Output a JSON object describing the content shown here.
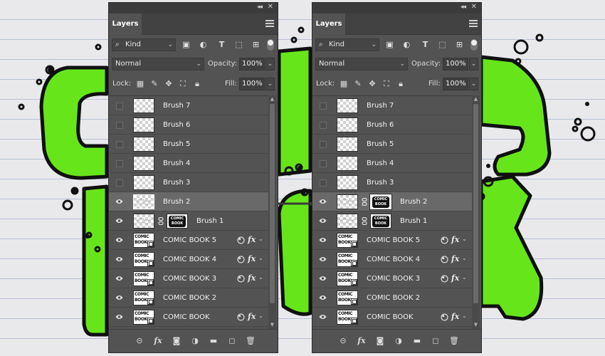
{
  "panel_left": {
    "tab_label": "Layers",
    "kind_label": "Kind",
    "blend_mode": "Normal",
    "opacity_label": "Opacity:",
    "opacity_value": "100%",
    "lock_label": "Lock:",
    "fill_label": "Fill:",
    "fill_value": "100%",
    "layers": [
      {
        "name": "Brush 7",
        "visible": false,
        "type": "pixel"
      },
      {
        "name": "Brush 6",
        "visible": false,
        "type": "pixel"
      },
      {
        "name": "Brush 5",
        "visible": false,
        "type": "pixel"
      },
      {
        "name": "Brush 4",
        "visible": false,
        "type": "pixel"
      },
      {
        "name": "Brush 3",
        "visible": false,
        "type": "pixel"
      },
      {
        "name": "Brush 2",
        "visible": true,
        "type": "pixel",
        "selected": true
      },
      {
        "name": "Brush 1",
        "visible": true,
        "type": "masked",
        "mask_text": "COMIC BOOK"
      },
      {
        "name": "COMIC BOOK 5",
        "visible": true,
        "type": "smart",
        "fx": true
      },
      {
        "name": "COMIC BOOK 4",
        "visible": true,
        "type": "smart",
        "fx": true
      },
      {
        "name": "COMIC BOOK 3",
        "visible": true,
        "type": "smart",
        "fx": true
      },
      {
        "name": "COMIC BOOK 2",
        "visible": true,
        "type": "smart",
        "fx": false
      },
      {
        "name": "COMIC BOOK",
        "visible": true,
        "type": "smart",
        "fx": true
      }
    ]
  },
  "panel_right": {
    "tab_label": "Layers",
    "kind_label": "Kind",
    "blend_mode": "Normal",
    "opacity_label": "Opacity:",
    "opacity_value": "100%",
    "lock_label": "Lock:",
    "fill_label": "Fill:",
    "fill_value": "100%",
    "layers": [
      {
        "name": "Brush 7",
        "visible": false,
        "type": "pixel"
      },
      {
        "name": "Brush 6",
        "visible": false,
        "type": "pixel"
      },
      {
        "name": "Brush 5",
        "visible": false,
        "type": "pixel"
      },
      {
        "name": "Brush 4",
        "visible": false,
        "type": "pixel"
      },
      {
        "name": "Brush 3",
        "visible": false,
        "type": "pixel"
      },
      {
        "name": "Brush 2",
        "visible": true,
        "type": "masked",
        "selected": true,
        "mask_text": "COMIC BOOK"
      },
      {
        "name": "Brush 1",
        "visible": true,
        "type": "masked",
        "mask_text": "COMIC BOOK"
      },
      {
        "name": "COMIC BOOK 5",
        "visible": true,
        "type": "smart",
        "fx": true
      },
      {
        "name": "COMIC BOOK 4",
        "visible": true,
        "type": "smart",
        "fx": true
      },
      {
        "name": "COMIC BOOK 3",
        "visible": true,
        "type": "smart",
        "fx": true
      },
      {
        "name": "COMIC BOOK 2",
        "visible": true,
        "type": "smart",
        "fx": false
      },
      {
        "name": "COMIC BOOK",
        "visible": true,
        "type": "smart",
        "fx": true
      }
    ]
  },
  "thumb_text": "COMIC BOOK",
  "colors": {
    "panel_bg": "#535353",
    "selected_row": "#696969",
    "letter_green": "#66e61a",
    "paper_lines": "#b8bfd6"
  },
  "icons": {
    "filter": [
      "image-filter-icon",
      "adjustment-filter-icon",
      "type-filter-icon",
      "shape-filter-icon",
      "smart-object-filter-icon"
    ],
    "lock": [
      "lock-transparent-icon",
      "lock-image-icon",
      "lock-position-icon",
      "lock-artboard-icon",
      "lock-all-icon"
    ],
    "footer": [
      "link-layers-icon",
      "fx-icon",
      "add-mask-icon",
      "adjustment-layer-icon",
      "new-group-icon",
      "new-layer-icon",
      "delete-icon"
    ]
  }
}
